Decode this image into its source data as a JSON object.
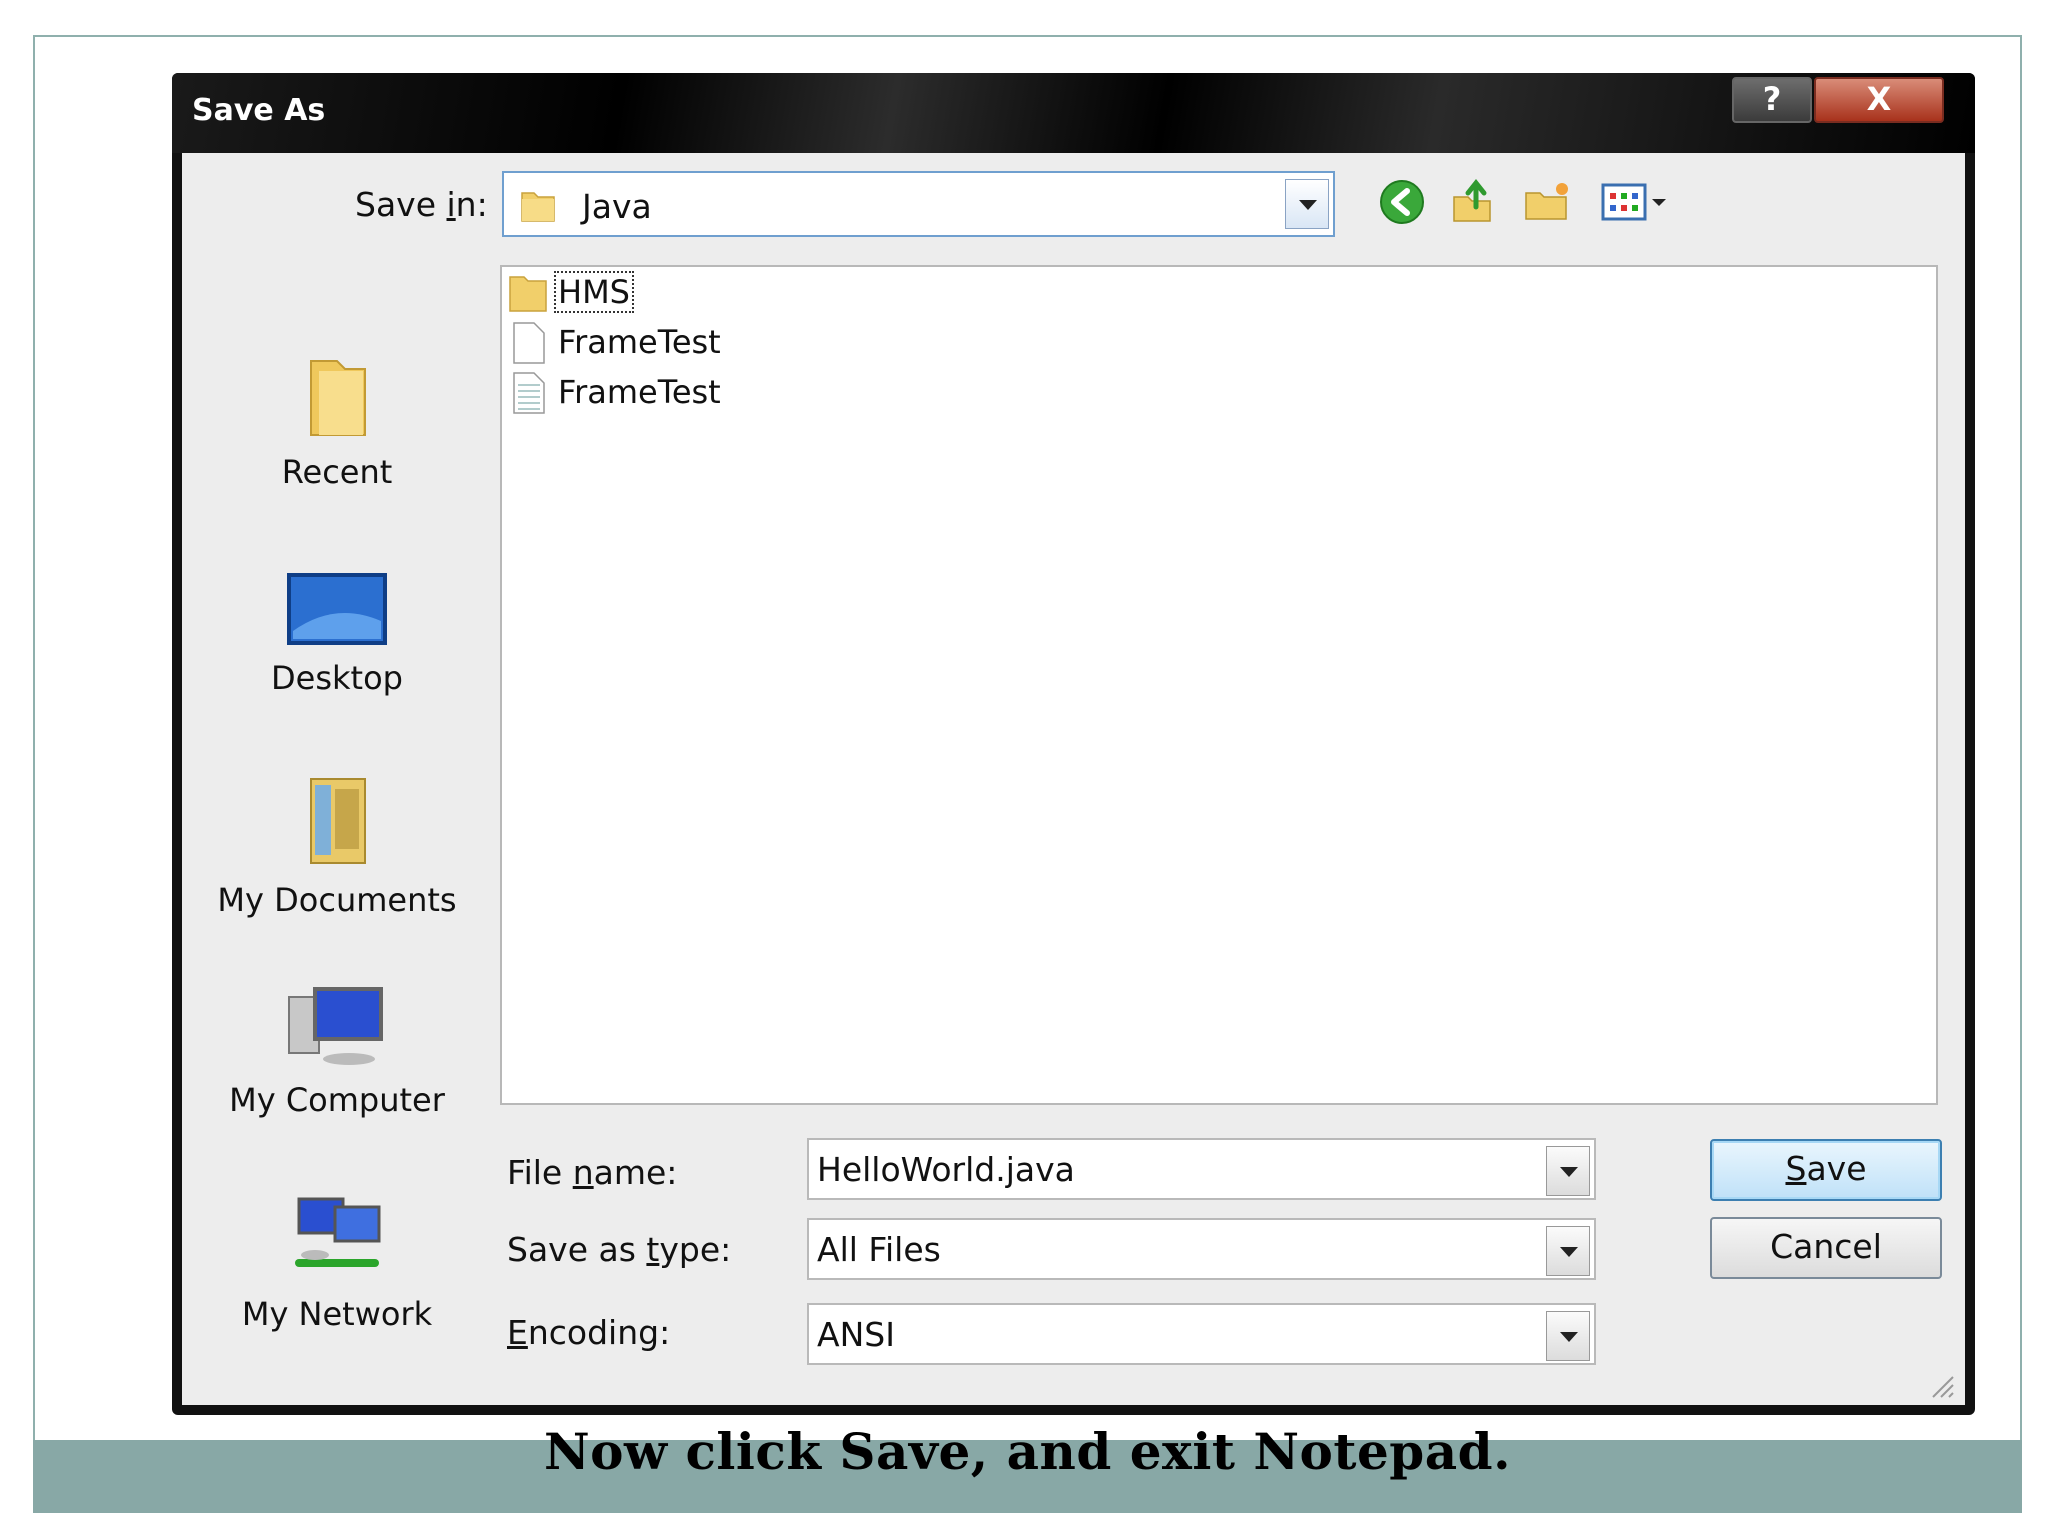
{
  "dialog": {
    "title": "Save As"
  },
  "titlebar": {
    "help_label": "?",
    "close_label": "X"
  },
  "save_in": {
    "label_pre": "Save ",
    "label_accel": "i",
    "label_post": "n:",
    "value": "Java"
  },
  "places": [
    {
      "label": "Recent",
      "icon": "recent-folder-icon"
    },
    {
      "label": "Desktop",
      "icon": "desktop-icon"
    },
    {
      "label": "My Documents",
      "icon": "my-documents-icon"
    },
    {
      "label": "My Computer",
      "icon": "my-computer-icon"
    },
    {
      "label": "My Network",
      "icon": "my-network-icon"
    }
  ],
  "files": [
    {
      "name": "HMS",
      "icon": "folder-icon"
    },
    {
      "name": "FrameTest",
      "icon": "blank-file-icon"
    },
    {
      "name": "FrameTest",
      "icon": "text-file-icon"
    }
  ],
  "fields": {
    "file_name": {
      "label_pre": "File ",
      "label_accel": "n",
      "label_post": "ame:",
      "value": "HelloWorld.java"
    },
    "save_as_type": {
      "label_pre": "Save as ",
      "label_accel": "t",
      "label_post": "ype:",
      "value": "All Files"
    },
    "encoding": {
      "label_pre": "",
      "label_accel": "E",
      "label_post": "ncoding:",
      "value": "ANSI"
    }
  },
  "buttons": {
    "save": {
      "accel": "S",
      "rest": "ave"
    },
    "cancel": "Cancel"
  },
  "caption": "Now click Save, and exit Notepad.",
  "colors": {
    "caption_band": "#88a8a6",
    "dialog_frame": "#111111",
    "client_bg": "#ededed",
    "combo_focus_border": "#6f9fcf"
  }
}
